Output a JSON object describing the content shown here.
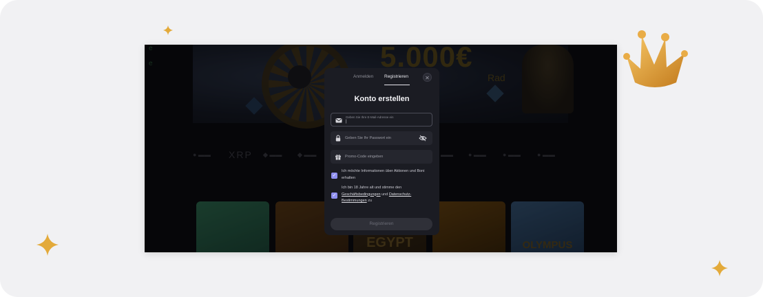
{
  "background": {
    "card_color": "#f1f1f3",
    "accent": "#e0a72a"
  },
  "decor": {
    "crown_icon": "crown-icon",
    "sparkle_icon": "sparkle-icon"
  },
  "banner": {
    "amount": "5.000€",
    "subtitle": "Rad"
  },
  "payments": [
    "XRP"
  ],
  "games": [
    {
      "title": ""
    },
    {
      "title": ""
    },
    {
      "title": "EGYPT"
    },
    {
      "title": ""
    },
    {
      "title": "OLYMPUS"
    }
  ],
  "modal": {
    "tabs": {
      "login": "Anmelden",
      "register": "Registrieren"
    },
    "close_icon": "close-icon",
    "title": "Konto erstellen",
    "email": {
      "placeholder": "Geben Sie Ihre E-Mail-Adresse ein",
      "value": "|"
    },
    "password": {
      "placeholder": "Geben Sie Ihr Passwort ein"
    },
    "promo": {
      "placeholder": "Promo-Code eingeben"
    },
    "checkbox_news": {
      "checked": true,
      "text": "Ich möchte Informationen über Aktionen und Boni erhalten"
    },
    "checkbox_terms": {
      "checked": true,
      "text_before": "Ich bin 18 Jahre alt und stimme den ",
      "terms_link": "Geschäftsbedingungen",
      "text_mid": " und ",
      "privacy_link": "Datenschutz-Bestimmungen",
      "text_after": " zu"
    },
    "submit_label": "Registrieren",
    "checkbox_color": "#8f8ff0"
  }
}
